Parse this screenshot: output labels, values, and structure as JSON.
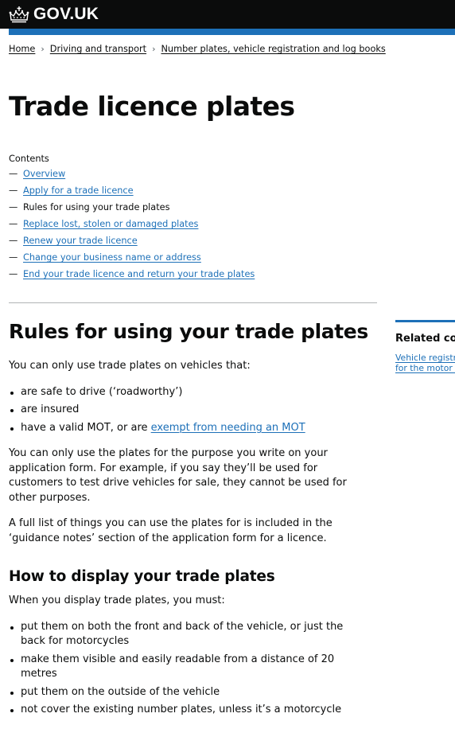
{
  "header": {
    "logo_text": "GOV.UK",
    "logo_icon": "crown-icon",
    "colors": {
      "header_bg": "#0b0c0c",
      "accent_bar": "#1d70b8",
      "link": "#1d70b8",
      "text": "#0b0c0c",
      "divider": "#b1b4b6"
    }
  },
  "breadcrumb": {
    "items": [
      {
        "label": "Home"
      },
      {
        "label": "Driving and transport"
      },
      {
        "label": "Number plates, vehicle registration and log books"
      }
    ],
    "separator": "›"
  },
  "page": {
    "title": "Trade licence plates"
  },
  "contents": {
    "label": "Contents",
    "dash": "—",
    "items": [
      {
        "label": "Overview",
        "current": false
      },
      {
        "label": "Apply for a trade licence",
        "current": false
      },
      {
        "label": "Rules for using your trade plates",
        "current": true
      },
      {
        "label": "Replace lost, stolen or damaged plates",
        "current": false
      },
      {
        "label": "Renew your trade licence",
        "current": false
      },
      {
        "label": "Change your business name or address",
        "current": false
      },
      {
        "label": "End your trade licence and return your trade plates",
        "current": false
      }
    ]
  },
  "main": {
    "heading": "Rules for using your trade plates",
    "intro": "You can only use trade plates on vehicles that:",
    "conditions": [
      "are safe to drive (‘roadworthy’)",
      "are insured"
    ],
    "condition_mot_prefix": "have a valid MOT, or are ",
    "condition_mot_link": "exempt from needing an MOT",
    "purpose_paragraph": "You can only use the plates for the purpose you write on your application form. For example, if you say they’ll be used for customers to test drive vehicles for sale, they cannot be used for other purposes.",
    "guidance_paragraph": "A full list of things you can use the plates for is included in the ‘guidance notes’ section of the application form for a licence.",
    "display_heading": "How to display your trade plates",
    "display_intro": "When you display trade plates, you must:",
    "display_rules": [
      "put them on both the front and back of the vehicle, or just the back for motorcycles",
      "make them visible and easily readable from a distance of 20 metres",
      "put them on the outside of the vehicle",
      "not cover the existing number plates, unless it’s a motorcycle"
    ]
  },
  "related": {
    "title": "Related content",
    "links": [
      {
        "label": "Vehicle registration for the motor trade"
      }
    ]
  }
}
